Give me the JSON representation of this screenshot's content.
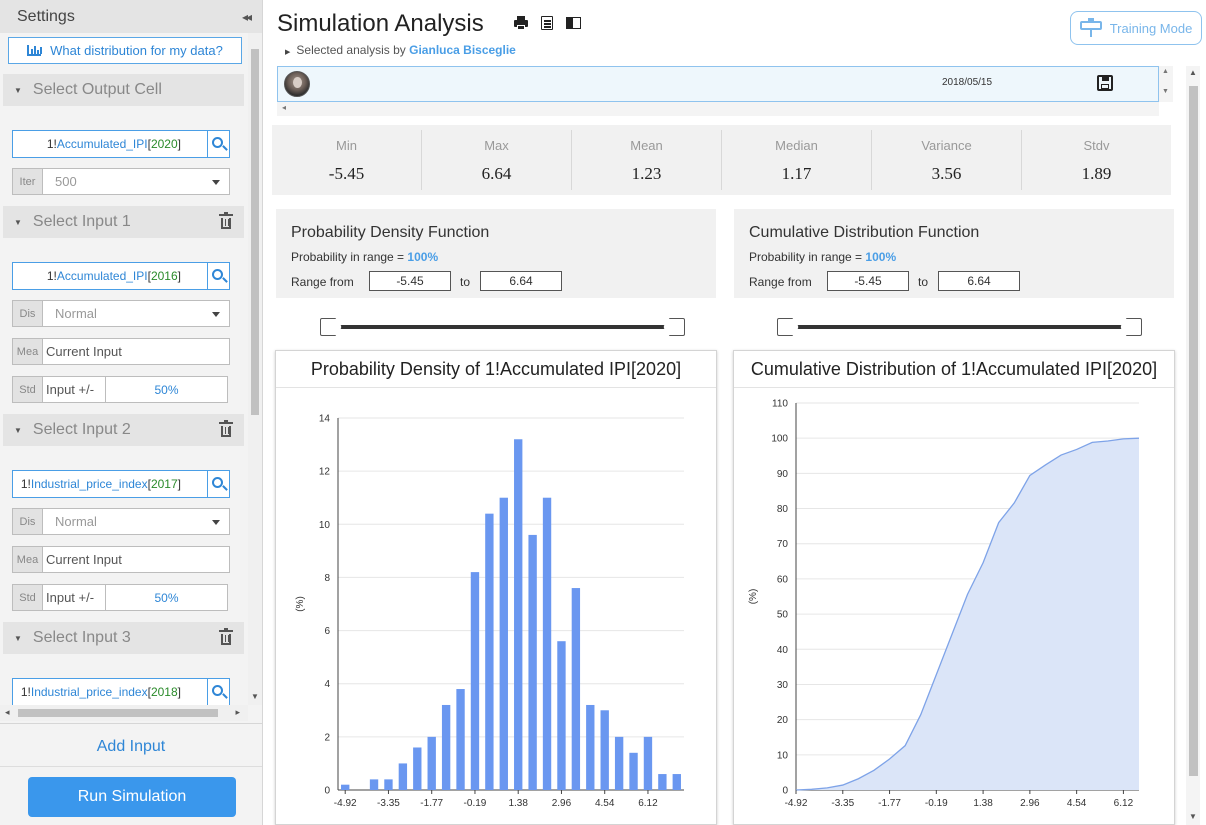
{
  "sidebar": {
    "title": "Settings",
    "distribution_button": "What distribution for my data?",
    "output_section": {
      "label": "Select Output Cell",
      "cell": {
        "prefix": "1!",
        "name": "Accumulated_IPI",
        "year": "2020"
      },
      "iter_tag": "Iter",
      "iter_value": "500"
    },
    "inputs": [
      {
        "label": "Select Input 1",
        "cell": {
          "prefix": "1!",
          "name": "Accumulated_IPI",
          "year": "2016"
        },
        "dis_tag": "Dis",
        "distribution": "Normal",
        "mea_tag": "Mea",
        "mean": "Current Input",
        "std_tag": "Std",
        "std_label": "Input +/-",
        "std_value": "50%"
      },
      {
        "label": "Select Input 2",
        "cell": {
          "prefix": "1!",
          "name": "Industrial_price_index",
          "year": "2017"
        },
        "dis_tag": "Dis",
        "distribution": "Normal",
        "mea_tag": "Mea",
        "mean": "Current Input",
        "std_tag": "Std",
        "std_label": "Input +/-",
        "std_value": "50%"
      },
      {
        "label": "Select Input 3",
        "cell": {
          "prefix": "1!",
          "name": "Industrial_price_index",
          "year": "2018"
        }
      }
    ],
    "add_input": "Add Input",
    "run_button": "Run Simulation"
  },
  "header": {
    "title": "Simulation Analysis",
    "subtitle_prefix": "Selected analysis by",
    "author": "Gianluca Bisceglie",
    "training_mode": "Training Mode"
  },
  "history": {
    "date": "2018/05/15"
  },
  "stats": [
    {
      "name": "Min",
      "value": "-5.45"
    },
    {
      "name": "Max",
      "value": "6.64"
    },
    {
      "name": "Mean",
      "value": "1.23"
    },
    {
      "name": "Median",
      "value": "1.17"
    },
    {
      "name": "Variance",
      "value": "3.56"
    },
    {
      "name": "Stdv",
      "value": "1.89"
    }
  ],
  "pdf_panel": {
    "title": "Probability Density Function",
    "prob_label": "Probability in range =",
    "prob_value": "100%",
    "range_label": "Range from",
    "from": "-5.45",
    "to_label": "to",
    "to": "6.64"
  },
  "cdf_panel": {
    "title": "Cumulative Distribution Function",
    "prob_label": "Probability in range =",
    "prob_value": "100%",
    "range_label": "Range from",
    "from": "-5.45",
    "to_label": "to",
    "to": "6.64"
  },
  "chart_data": [
    {
      "type": "bar",
      "title": "Probability Density of 1!Accumulated IPI[2020]",
      "ylabel": "(%)",
      "ylim": [
        0,
        14
      ],
      "yticks": [
        0,
        2,
        4,
        6,
        8,
        10,
        12,
        14
      ],
      "xtick_labels": [
        "-4.92",
        "-3.35",
        "-1.77",
        "-0.19",
        "1.38",
        "2.96",
        "4.54",
        "6.12"
      ],
      "xtick_index": [
        0,
        3,
        6,
        9,
        12,
        15,
        18,
        21
      ],
      "values": [
        0.2,
        0,
        0.4,
        0.4,
        1.0,
        1.6,
        2.0,
        3.2,
        3.8,
        8.2,
        10.4,
        11.0,
        13.2,
        9.6,
        11.0,
        5.6,
        7.6,
        3.2,
        3.0,
        2.0,
        1.4,
        2.0,
        0.6,
        0.6
      ],
      "color": "#6a97f0"
    },
    {
      "type": "area",
      "title": "Cumulative Distribution of 1!Accumulated IPI[2020]",
      "ylabel": "(%)",
      "ylim": [
        0,
        110
      ],
      "yticks": [
        0,
        10,
        20,
        30,
        40,
        50,
        60,
        70,
        80,
        90,
        100,
        110
      ],
      "xtick_labels": [
        "-4.92",
        "-3.35",
        "-1.77",
        "-0.19",
        "1.38",
        "2.96",
        "4.54",
        "6.12"
      ],
      "xtick_index": [
        0,
        3,
        6,
        9,
        12,
        15,
        18,
        21
      ],
      "values": [
        0,
        0.2,
        0.6,
        1.4,
        3.2,
        5.6,
        8.8,
        12.6,
        21.4,
        32.8,
        44.2,
        55.6,
        64.6,
        76.0,
        81.6,
        89.4,
        92.4,
        95.2,
        96.8,
        98.8,
        99.2,
        99.8,
        100
      ],
      "color": "#7ea3e8"
    }
  ]
}
